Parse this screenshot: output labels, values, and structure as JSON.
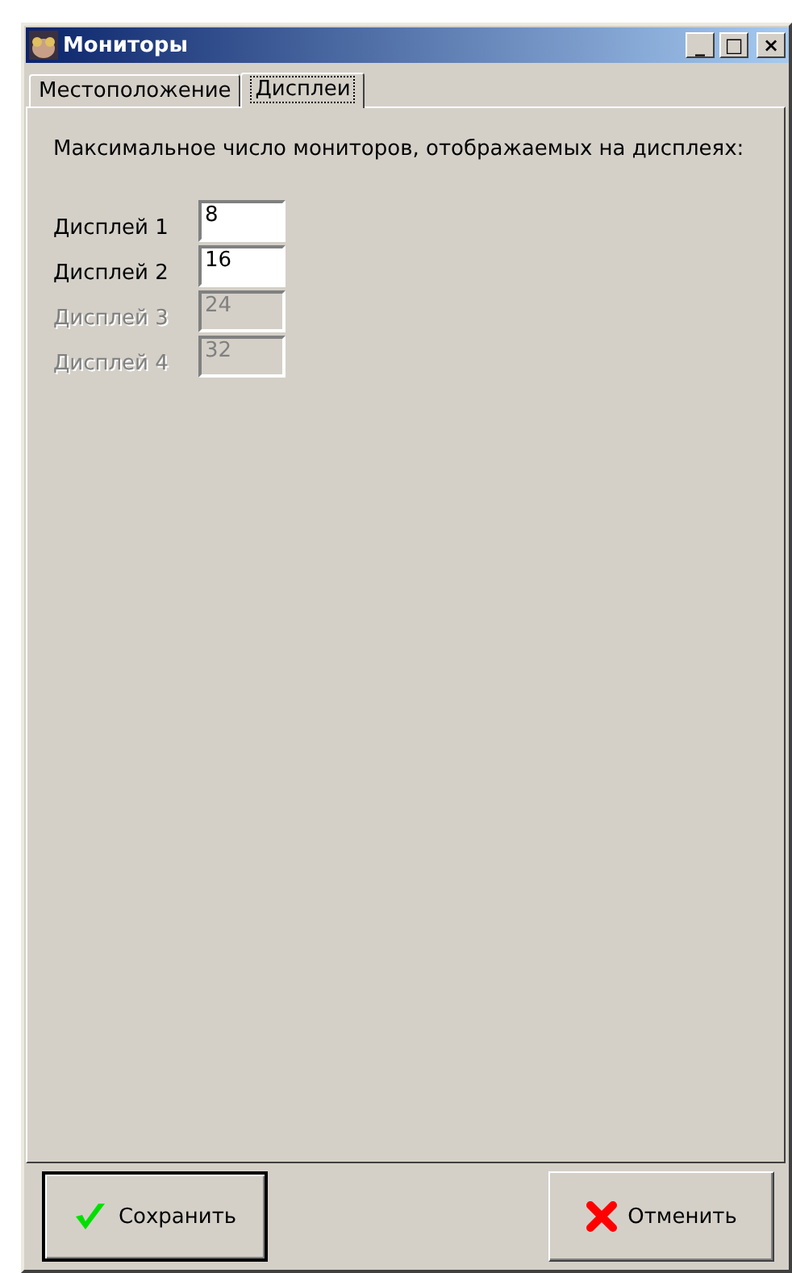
{
  "window": {
    "title": "Мониторы",
    "controls": [
      "_",
      "□",
      "×"
    ]
  },
  "tabs": [
    {
      "label": "Местоположение",
      "selected": false
    },
    {
      "label": "Дисплеи",
      "selected": true
    }
  ],
  "panel": {
    "heading": "Максимальное число мониторов, отображаемых на дисплеях:",
    "displays": [
      {
        "label": "Дисплей 1",
        "value": "8",
        "disabled": false
      },
      {
        "label": "Дисплей 2",
        "value": "16",
        "disabled": false
      },
      {
        "label": "Дисплей 3",
        "value": "24",
        "disabled": true
      },
      {
        "label": "Дисплей 4",
        "value": "32",
        "disabled": true
      }
    ]
  },
  "buttons": [
    {
      "kind": "save",
      "label": "Сохранить",
      "default": true
    },
    {
      "kind": "cancel",
      "label": "Отменить",
      "default": false
    }
  ]
}
